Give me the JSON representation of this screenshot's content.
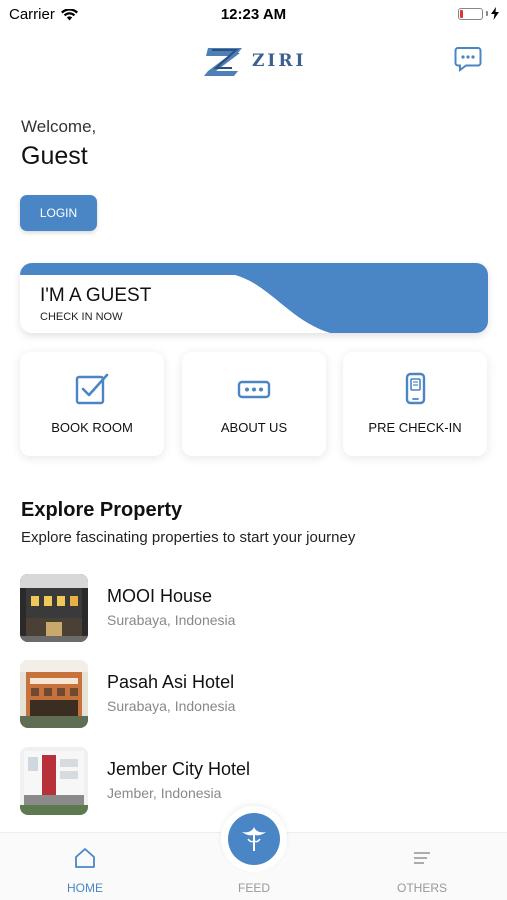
{
  "status_bar": {
    "carrier": "Carrier",
    "time": "12:23 AM",
    "battery_level": 0.15,
    "battery_color": "#e0343a"
  },
  "header": {
    "logo_text": "ZIRI",
    "chat_icon": "chat-bubble-icon"
  },
  "welcome": {
    "greeting": "Welcome,",
    "name": "Guest",
    "login_label": "LOGIN"
  },
  "guest_banner": {
    "title": "I'M A GUEST",
    "subtitle": "CHECK IN NOW"
  },
  "menu": [
    {
      "label": "BOOK ROOM",
      "icon": "checkbox-edit-icon"
    },
    {
      "label": "ABOUT US",
      "icon": "card-dots-icon"
    },
    {
      "label": "PRE CHECK-IN",
      "icon": "mobile-phone-icon"
    }
  ],
  "explore": {
    "title": "Explore Property",
    "subtitle": "Explore fascinating properties to start your journey"
  },
  "properties": [
    {
      "name": "MOOI House",
      "location": "Surabaya, Indonesia"
    },
    {
      "name": "Pasah Asi Hotel",
      "location": "Surabaya, Indonesia"
    },
    {
      "name": "Jember City Hotel",
      "location": "Jember, Indonesia"
    }
  ],
  "tabs": [
    {
      "label": "HOME",
      "icon": "home-icon",
      "active": true
    },
    {
      "label": "FEED",
      "icon": "feed-logo-icon",
      "active": false
    },
    {
      "label": "OTHERS",
      "icon": "menu-lines-icon",
      "active": false
    }
  ],
  "colors": {
    "accent": "#4a86c5",
    "brand_dark": "#3b5f8f",
    "muted_text": "#888888"
  }
}
